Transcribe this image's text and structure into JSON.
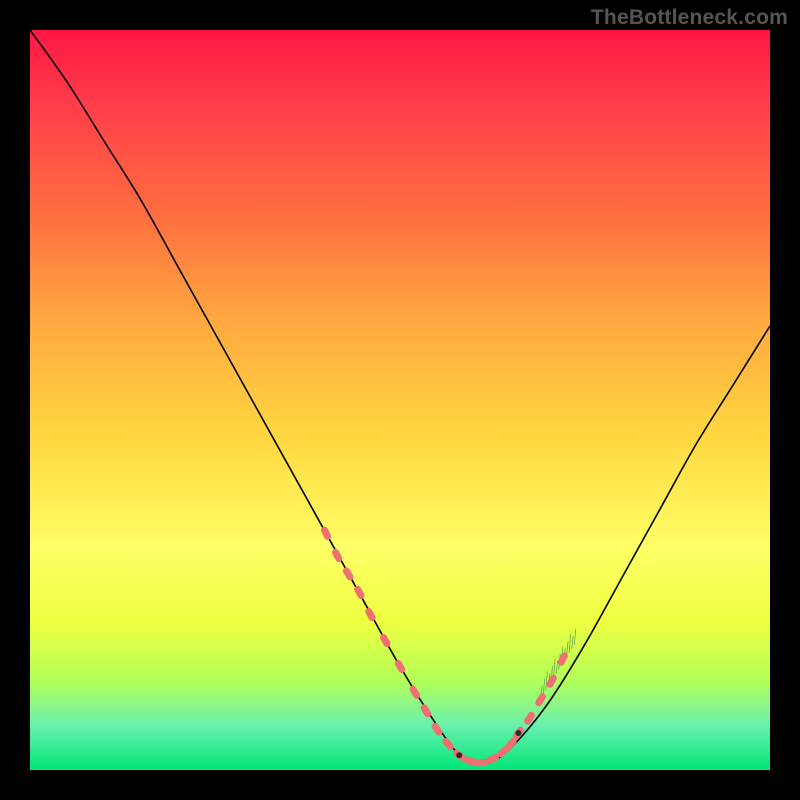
{
  "watermark": "TheBottleneck.com",
  "colors": {
    "gradient_top": "#ff1744",
    "gradient_mid1": "#ffab40",
    "gradient_mid2": "#ffff66",
    "gradient_bottom": "#00e676",
    "curve": "#000000",
    "marker": "#ef6f72",
    "frame": "#000000"
  },
  "chart_data": {
    "type": "line",
    "title": "",
    "xlabel": "",
    "ylabel": "",
    "xlim": [
      0,
      100
    ],
    "ylim": [
      0,
      100
    ],
    "grid": false,
    "legend": false,
    "series": [
      {
        "name": "bottleneck-curve",
        "x": [
          0,
          5,
          10,
          15,
          20,
          25,
          30,
          35,
          40,
          45,
          50,
          55,
          58,
          60,
          62,
          65,
          70,
          75,
          80,
          85,
          90,
          95,
          100
        ],
        "y": [
          100,
          93,
          85,
          77,
          68,
          59,
          50,
          41,
          32,
          23,
          14,
          6,
          2,
          1,
          1,
          3,
          9,
          17,
          26,
          35,
          44,
          52,
          60
        ]
      }
    ],
    "highlighted_range_x": [
      40,
      66
    ],
    "markers": [
      {
        "x": 40.0,
        "y": 32.0
      },
      {
        "x": 41.5,
        "y": 29.0
      },
      {
        "x": 43.0,
        "y": 26.5
      },
      {
        "x": 44.5,
        "y": 24.0
      },
      {
        "x": 46.0,
        "y": 21.0
      },
      {
        "x": 48.0,
        "y": 17.5
      },
      {
        "x": 50.0,
        "y": 14.0
      },
      {
        "x": 52.0,
        "y": 10.5
      },
      {
        "x": 53.5,
        "y": 8.0
      },
      {
        "x": 55.0,
        "y": 5.5
      },
      {
        "x": 56.5,
        "y": 3.5
      },
      {
        "x": 58.0,
        "y": 2.0
      },
      {
        "x": 59.5,
        "y": 1.2
      },
      {
        "x": 61.0,
        "y": 1.0
      },
      {
        "x": 62.5,
        "y": 1.5
      },
      {
        "x": 64.0,
        "y": 2.5
      },
      {
        "x": 65.0,
        "y": 3.5
      },
      {
        "x": 66.0,
        "y": 5.0
      },
      {
        "x": 67.5,
        "y": 7.0
      },
      {
        "x": 69.0,
        "y": 9.5
      },
      {
        "x": 70.5,
        "y": 12.0
      },
      {
        "x": 72.0,
        "y": 15.0
      }
    ]
  }
}
